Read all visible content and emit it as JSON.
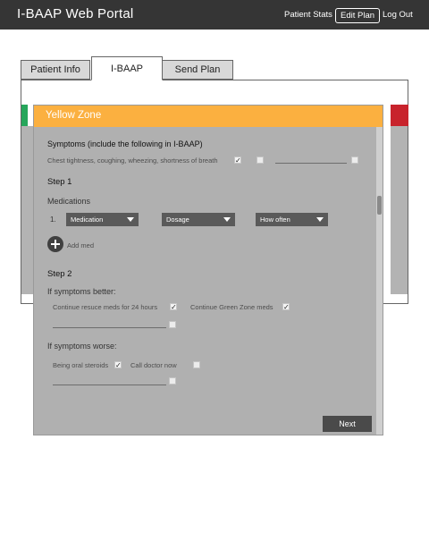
{
  "app": {
    "title": "I-BAAP Web Portal"
  },
  "nav": {
    "patient_stats": "Patient Stats",
    "edit_plan": "Edit Plan",
    "log_out": "Log Out"
  },
  "tabs": [
    {
      "label": "Patient Info"
    },
    {
      "label": "I-BAAP"
    },
    {
      "label": "Send Plan"
    }
  ],
  "modal": {
    "title": "Yellow Zone",
    "symptoms_heading": "Symptoms (include the following in I-BAAP)",
    "symptoms_text": "Chest tightness, coughing, wheezing, shortness of breath",
    "step1": {
      "heading": "Step 1",
      "medications_label": "Medications",
      "row_number": "1.",
      "medication": "Medication",
      "dosage": "Dosage",
      "how_often": "How often",
      "add_med": "Add med"
    },
    "step2": {
      "heading": "Step 2",
      "better_label": "If symptoms better:",
      "continue_rescue": "Continue resuce meds for 24 hours",
      "continue_green": "Continue Green Zone meds",
      "worse_label": "If symptoms worse:",
      "oral_steroids": "Being oral steroids",
      "call_doctor": "Call doctor now"
    },
    "next": "Next"
  },
  "colors": {
    "topbar": "#353535",
    "yellow_zone": "#fbb040",
    "green_zone": "#26a65b",
    "red_zone": "#c8232c"
  }
}
